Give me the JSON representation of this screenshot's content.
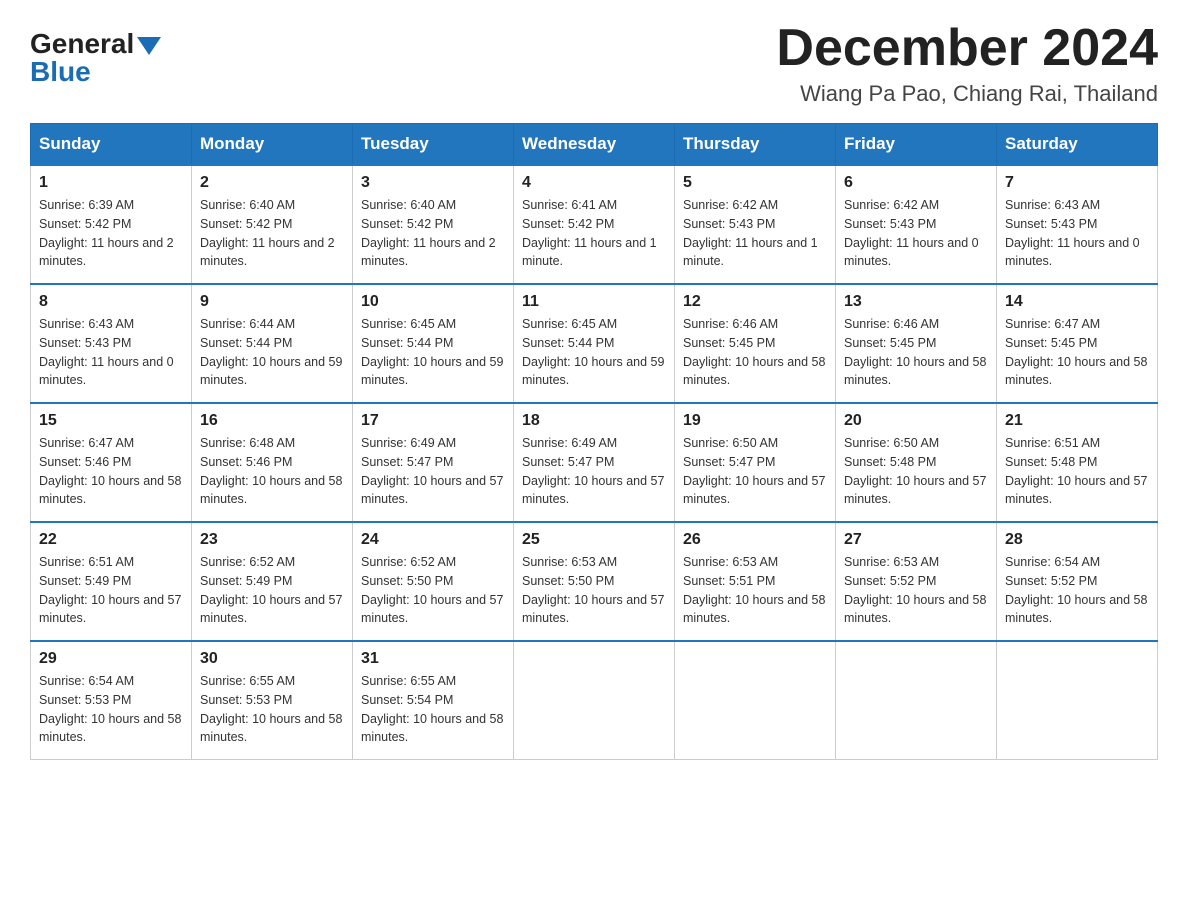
{
  "header": {
    "logo": {
      "general": "General",
      "blue": "Blue",
      "triangle_label": "logo-triangle"
    },
    "month_title": "December 2024",
    "location": "Wiang Pa Pao, Chiang Rai, Thailand"
  },
  "calendar": {
    "days_of_week": [
      "Sunday",
      "Monday",
      "Tuesday",
      "Wednesday",
      "Thursday",
      "Friday",
      "Saturday"
    ],
    "weeks": [
      [
        {
          "day": "1",
          "sunrise": "6:39 AM",
          "sunset": "5:42 PM",
          "daylight": "11 hours and 2 minutes."
        },
        {
          "day": "2",
          "sunrise": "6:40 AM",
          "sunset": "5:42 PM",
          "daylight": "11 hours and 2 minutes."
        },
        {
          "day": "3",
          "sunrise": "6:40 AM",
          "sunset": "5:42 PM",
          "daylight": "11 hours and 2 minutes."
        },
        {
          "day": "4",
          "sunrise": "6:41 AM",
          "sunset": "5:42 PM",
          "daylight": "11 hours and 1 minute."
        },
        {
          "day": "5",
          "sunrise": "6:42 AM",
          "sunset": "5:43 PM",
          "daylight": "11 hours and 1 minute."
        },
        {
          "day": "6",
          "sunrise": "6:42 AM",
          "sunset": "5:43 PM",
          "daylight": "11 hours and 0 minutes."
        },
        {
          "day": "7",
          "sunrise": "6:43 AM",
          "sunset": "5:43 PM",
          "daylight": "11 hours and 0 minutes."
        }
      ],
      [
        {
          "day": "8",
          "sunrise": "6:43 AM",
          "sunset": "5:43 PM",
          "daylight": "11 hours and 0 minutes."
        },
        {
          "day": "9",
          "sunrise": "6:44 AM",
          "sunset": "5:44 PM",
          "daylight": "10 hours and 59 minutes."
        },
        {
          "day": "10",
          "sunrise": "6:45 AM",
          "sunset": "5:44 PM",
          "daylight": "10 hours and 59 minutes."
        },
        {
          "day": "11",
          "sunrise": "6:45 AM",
          "sunset": "5:44 PM",
          "daylight": "10 hours and 59 minutes."
        },
        {
          "day": "12",
          "sunrise": "6:46 AM",
          "sunset": "5:45 PM",
          "daylight": "10 hours and 58 minutes."
        },
        {
          "day": "13",
          "sunrise": "6:46 AM",
          "sunset": "5:45 PM",
          "daylight": "10 hours and 58 minutes."
        },
        {
          "day": "14",
          "sunrise": "6:47 AM",
          "sunset": "5:45 PM",
          "daylight": "10 hours and 58 minutes."
        }
      ],
      [
        {
          "day": "15",
          "sunrise": "6:47 AM",
          "sunset": "5:46 PM",
          "daylight": "10 hours and 58 minutes."
        },
        {
          "day": "16",
          "sunrise": "6:48 AM",
          "sunset": "5:46 PM",
          "daylight": "10 hours and 58 minutes."
        },
        {
          "day": "17",
          "sunrise": "6:49 AM",
          "sunset": "5:47 PM",
          "daylight": "10 hours and 57 minutes."
        },
        {
          "day": "18",
          "sunrise": "6:49 AM",
          "sunset": "5:47 PM",
          "daylight": "10 hours and 57 minutes."
        },
        {
          "day": "19",
          "sunrise": "6:50 AM",
          "sunset": "5:47 PM",
          "daylight": "10 hours and 57 minutes."
        },
        {
          "day": "20",
          "sunrise": "6:50 AM",
          "sunset": "5:48 PM",
          "daylight": "10 hours and 57 minutes."
        },
        {
          "day": "21",
          "sunrise": "6:51 AM",
          "sunset": "5:48 PM",
          "daylight": "10 hours and 57 minutes."
        }
      ],
      [
        {
          "day": "22",
          "sunrise": "6:51 AM",
          "sunset": "5:49 PM",
          "daylight": "10 hours and 57 minutes."
        },
        {
          "day": "23",
          "sunrise": "6:52 AM",
          "sunset": "5:49 PM",
          "daylight": "10 hours and 57 minutes."
        },
        {
          "day": "24",
          "sunrise": "6:52 AM",
          "sunset": "5:50 PM",
          "daylight": "10 hours and 57 minutes."
        },
        {
          "day": "25",
          "sunrise": "6:53 AM",
          "sunset": "5:50 PM",
          "daylight": "10 hours and 57 minutes."
        },
        {
          "day": "26",
          "sunrise": "6:53 AM",
          "sunset": "5:51 PM",
          "daylight": "10 hours and 58 minutes."
        },
        {
          "day": "27",
          "sunrise": "6:53 AM",
          "sunset": "5:52 PM",
          "daylight": "10 hours and 58 minutes."
        },
        {
          "day": "28",
          "sunrise": "6:54 AM",
          "sunset": "5:52 PM",
          "daylight": "10 hours and 58 minutes."
        }
      ],
      [
        {
          "day": "29",
          "sunrise": "6:54 AM",
          "sunset": "5:53 PM",
          "daylight": "10 hours and 58 minutes."
        },
        {
          "day": "30",
          "sunrise": "6:55 AM",
          "sunset": "5:53 PM",
          "daylight": "10 hours and 58 minutes."
        },
        {
          "day": "31",
          "sunrise": "6:55 AM",
          "sunset": "5:54 PM",
          "daylight": "10 hours and 58 minutes."
        },
        null,
        null,
        null,
        null
      ]
    ]
  }
}
